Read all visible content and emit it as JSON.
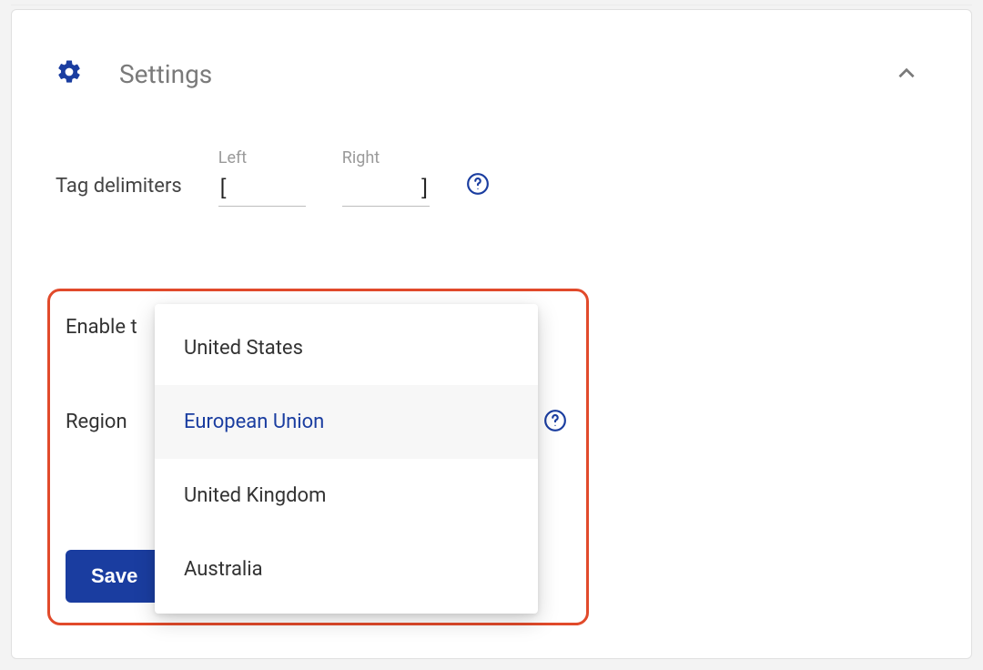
{
  "header": {
    "title": "Settings"
  },
  "delimiters": {
    "label": "Tag delimiters",
    "left_hint": "Left",
    "right_hint": "Right",
    "left_value": "[",
    "right_value": "]"
  },
  "enable": {
    "label_visible": "Enable t"
  },
  "region": {
    "label": "Region",
    "options": [
      "United States",
      "European Union",
      "United Kingdom",
      "Australia"
    ],
    "selected_index": 1
  },
  "buttons": {
    "save": "Save"
  }
}
